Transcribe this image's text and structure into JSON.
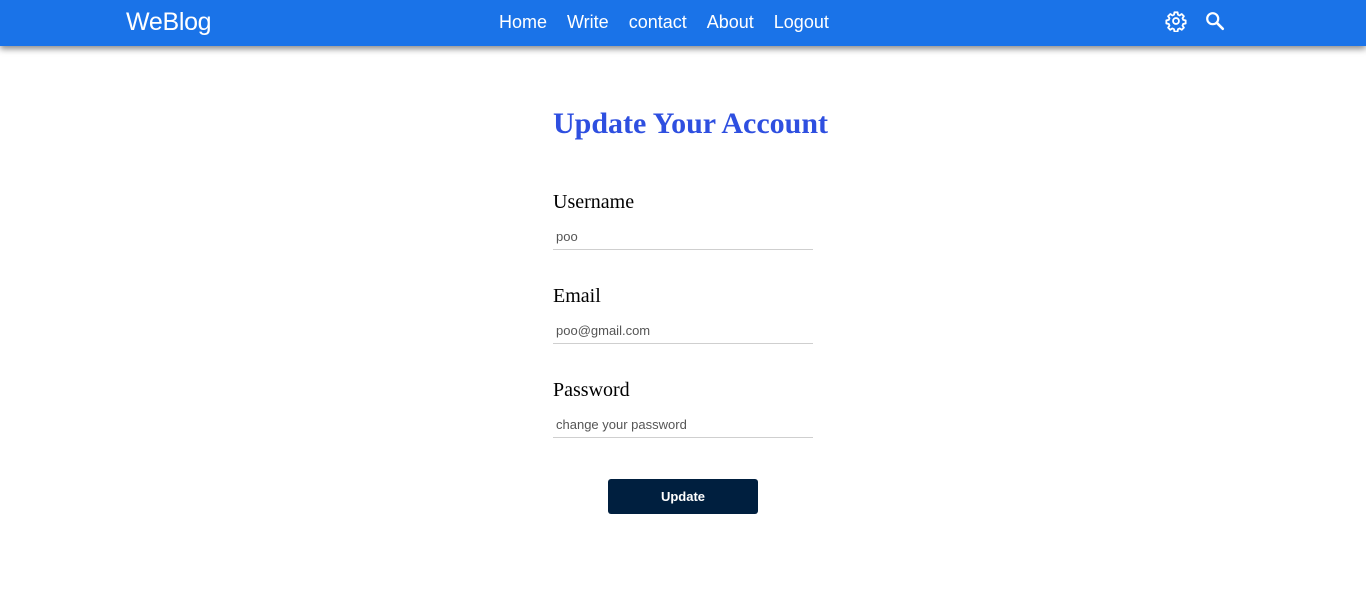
{
  "navbar": {
    "brand": "WeBlog",
    "links": [
      "Home",
      "Write",
      "contact",
      "About",
      "Logout"
    ],
    "icons": [
      "gear-icon",
      "search-icon"
    ],
    "background_color": "#1a73e8"
  },
  "form": {
    "title": "Update Your Account",
    "title_color": "#2e4fe0",
    "fields": [
      {
        "label": "Username",
        "placeholder": "poo"
      },
      {
        "label": "Email",
        "placeholder": "poo@gmail.com"
      },
      {
        "label": "Password",
        "placeholder": "change your password"
      }
    ],
    "submit_label": "Update",
    "submit_color": "#001f3f"
  }
}
